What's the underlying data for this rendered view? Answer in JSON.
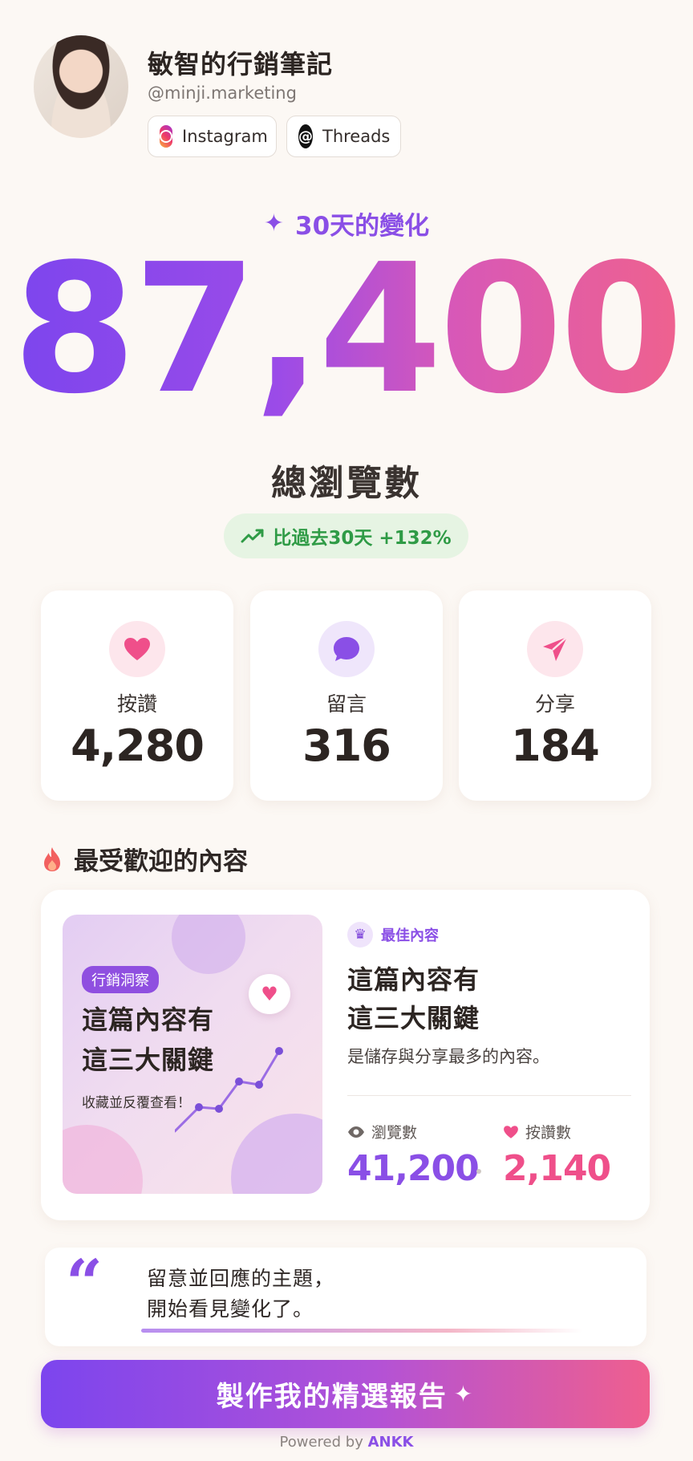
{
  "profile": {
    "name": "敏智的行銷筆記",
    "handle": "@minji.marketing",
    "platforms": [
      "Instagram",
      "Threads"
    ]
  },
  "hero": {
    "period": "30天的變化",
    "total": "87,400",
    "total_label": "總瀏覽數",
    "growth": "比過去30天 +132%"
  },
  "stats": [
    {
      "label": "按讚",
      "value": "4,280",
      "icon": "heart-icon"
    },
    {
      "label": "留言",
      "value": "316",
      "icon": "comment-icon"
    },
    {
      "label": "分享",
      "value": "184",
      "icon": "send-icon"
    }
  ],
  "popular": {
    "section_title": "最受歡迎的內容",
    "thumb": {
      "tag": "行銷洞察",
      "title_line1": "這篇內容有",
      "title_line2": "這三大關鍵",
      "subtitle": "收藏並反覆查看！"
    },
    "badge": "最佳內容",
    "title_line1": "這篇內容有",
    "title_line2": "這三大關鍵",
    "description": "是儲存與分享最多的內容。",
    "views_label": "瀏覽數",
    "views": "41,200",
    "likes_label": "按讚數",
    "likes": "2,140"
  },
  "quote": {
    "mark": "“",
    "line1": "留意並回應的主題，",
    "line2": "開始看見變化了。"
  },
  "cta": {
    "label": "製作我的精選報告"
  },
  "footer": {
    "powered_by": "Powered by",
    "brand": "ANKK"
  },
  "colors": {
    "accent_purple": "#8a4fe6",
    "accent_pink": "#ef5f8e",
    "growth_green": "#2f9b46",
    "background": "#fcf8f4"
  }
}
